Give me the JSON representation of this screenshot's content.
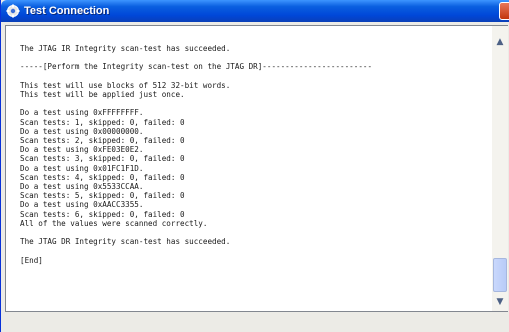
{
  "window": {
    "title": "Test Connection",
    "title_icon": "gear-icon",
    "close_icon": "close-icon"
  },
  "log": {
    "lines": [
      "The JTAG IR Integrity scan-test has succeeded.",
      "",
      "-----[Perform the Integrity scan-test on the JTAG DR]------------------------",
      "",
      "This test will use blocks of 512 32-bit words.",
      "This test will be applied just once.",
      "",
      "Do a test using 0xFFFFFFFF.",
      "Scan tests: 1, skipped: 0, failed: 0",
      "Do a test using 0x00000000.",
      "Scan tests: 2, skipped: 0, failed: 0",
      "Do a test using 0xFE03E0E2.",
      "Scan tests: 3, skipped: 0, failed: 0",
      "Do a test using 0x01FC1F1D.",
      "Scan tests: 4, skipped: 0, failed: 0",
      "Do a test using 0x5533CCAA.",
      "Scan tests: 5, skipped: 0, failed: 0",
      "Do a test using 0xAACC3355.",
      "Scan tests: 6, skipped: 0, failed: 0",
      "All of the values were scanned correctly.",
      "",
      "The JTAG DR Integrity scan-test has succeeded.",
      "",
      "[End]"
    ]
  },
  "scrollbar": {
    "up_icon": "chevron-up-icon",
    "down_icon": "chevron-down-icon",
    "position": 0.92
  }
}
